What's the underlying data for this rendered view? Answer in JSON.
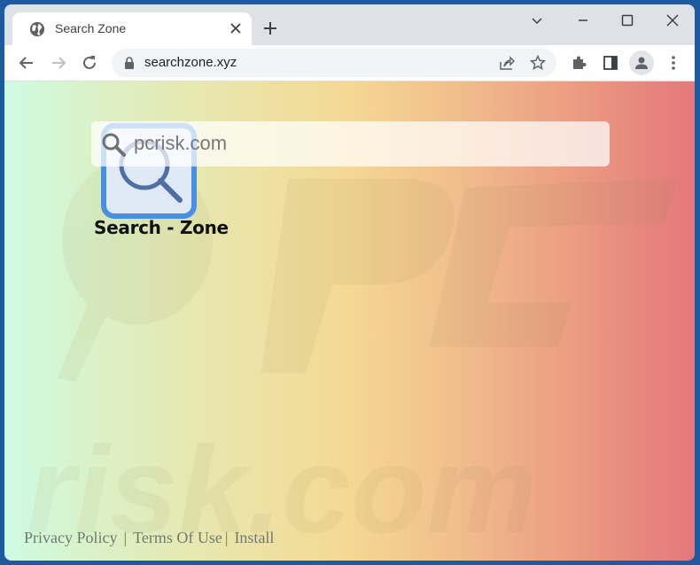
{
  "browser": {
    "tab": {
      "title": "Search Zone",
      "icon": "globe-icon",
      "close_icon": "close-icon"
    },
    "new_tab_icon": "plus-icon",
    "window_controls": [
      "chevron-down-icon",
      "minimize-icon",
      "maximize-icon",
      "close-icon"
    ],
    "nav": {
      "back_icon": "arrow-left-icon",
      "forward_icon": "arrow-right-icon",
      "reload_icon": "reload-icon"
    },
    "address_bar": {
      "url": "searchzone.xyz",
      "lock_icon": "lock-icon",
      "share_icon": "share-icon",
      "bookmark_icon": "star-icon"
    },
    "toolbar_icons": [
      "extensions-icon",
      "side-panel-icon",
      "profile-icon",
      "more-menu-icon"
    ]
  },
  "page": {
    "search": {
      "value": "pcrisk.com",
      "icon": "search-icon"
    },
    "logo_text": "Search - Zone",
    "footer": {
      "links": [
        "Privacy Policy",
        "Terms Of Use",
        "Install"
      ],
      "separator": "|"
    },
    "colors": {
      "gradient_start": "#cffbe3",
      "gradient_mid": "#f4d893",
      "gradient_end": "#e4787a",
      "logo_blue": "#4a90e2"
    },
    "watermark_text": "risk.com"
  }
}
